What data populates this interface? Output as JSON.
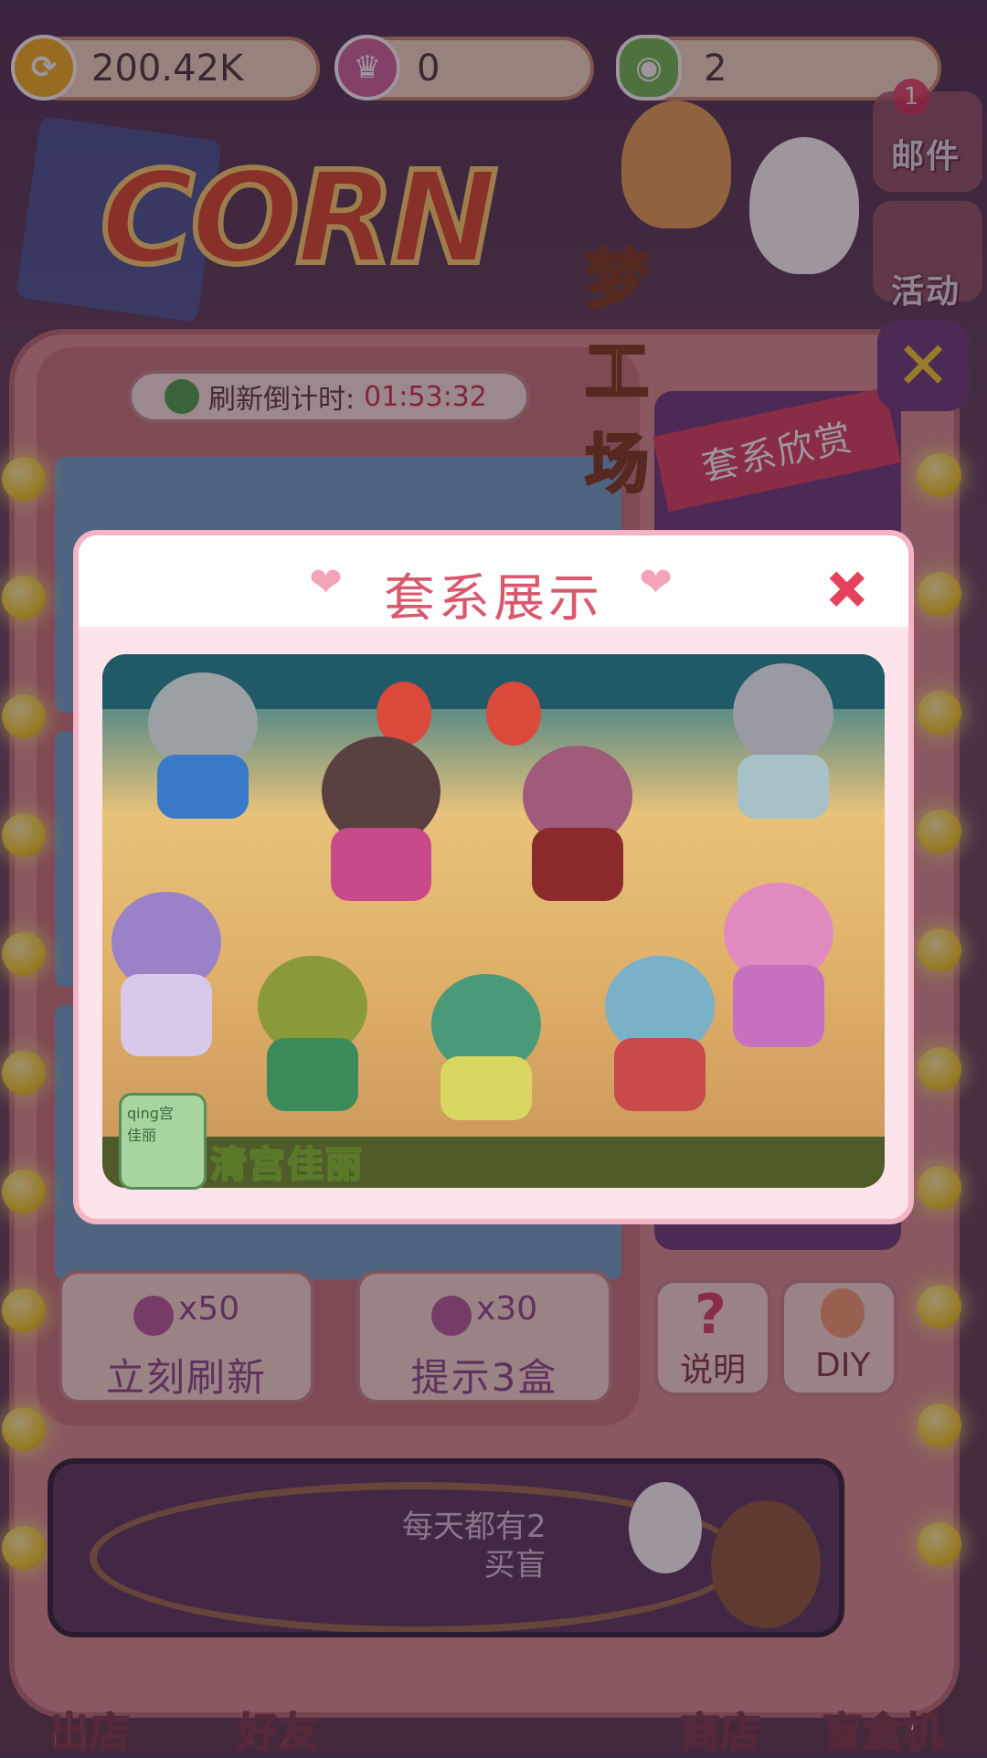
{
  "resources": [
    {
      "icon": "coin-icon",
      "value": "200.42K",
      "color": "#f2b51a"
    },
    {
      "icon": "crown-gem-icon",
      "value": "0",
      "color": "#d0679b"
    },
    {
      "icon": "frog-token-icon",
      "value": "2",
      "color": "#6cbf4f"
    }
  ],
  "logo": {
    "title": "CORN",
    "subtitle": "梦工场"
  },
  "side_buttons": {
    "mail": "邮件",
    "events": "活动",
    "mail_badge": "1"
  },
  "timer": {
    "label": "刷新倒计时:",
    "value": "01:53:32"
  },
  "series_tab": "套系欣赏",
  "modal": {
    "title": "套系展示",
    "set_name": "清宫佳丽",
    "set_icon_text": "qing宫\n佳丽"
  },
  "actions": [
    {
      "cost": "x50",
      "label": "立刻刷新"
    },
    {
      "cost": "x30",
      "label": "提示3盒"
    }
  ],
  "square_buttons": {
    "help": "说明",
    "diy": "DIY"
  },
  "promo": {
    "line1": "每天都有2",
    "line2": "买盲"
  },
  "bottom_nav": [
    "出店",
    "好友",
    "商店",
    "盲盒机"
  ],
  "colors": {
    "accent": "#d9586e",
    "modal_border": "#f5b3c4",
    "machine": "#d9908f"
  }
}
